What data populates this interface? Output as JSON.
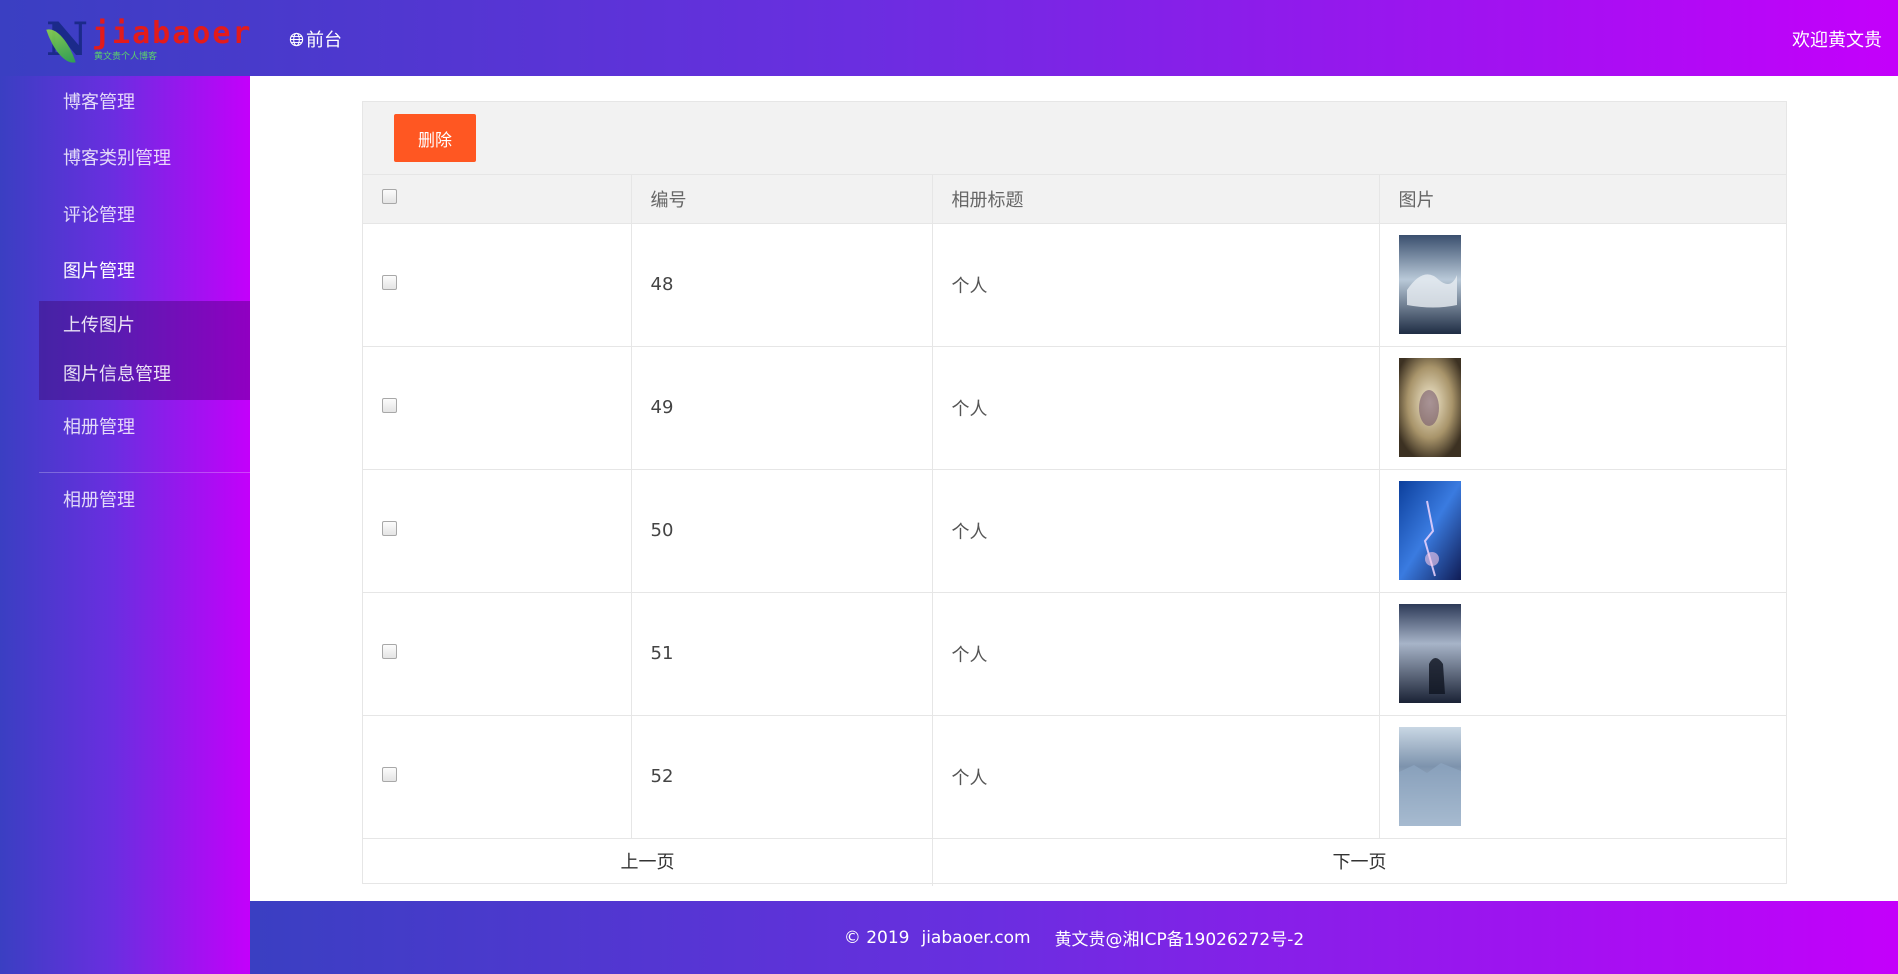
{
  "header": {
    "logo_text": "jiabaoer",
    "logo_subtitle": "黄文贵个人博客",
    "front_link": "前台",
    "welcome": "欢迎黄文贵"
  },
  "sidebar": {
    "items": [
      {
        "label": "博客管理"
      },
      {
        "label": "博客类别管理"
      },
      {
        "label": "评论管理"
      },
      {
        "label": "图片管理"
      },
      {
        "label": "相册管理"
      },
      {
        "label": "相册管理"
      }
    ],
    "sub_items": [
      {
        "label": "上传图片"
      },
      {
        "label": "图片信息管理"
      }
    ]
  },
  "toolbar": {
    "delete_label": "删除"
  },
  "table": {
    "headers": [
      "编号",
      "相册标题",
      "图片"
    ],
    "rows": [
      {
        "id": "48",
        "title": "个人"
      },
      {
        "id": "49",
        "title": "个人"
      },
      {
        "id": "50",
        "title": "个人"
      },
      {
        "id": "51",
        "title": "个人"
      },
      {
        "id": "52",
        "title": "个人"
      }
    ]
  },
  "pager": {
    "prev": "上一页",
    "next": "下一页"
  },
  "footer": {
    "copyright": "© 2019",
    "site": "jiabaoer.com",
    "icp": "黄文贵@湘ICP备19026272号-2"
  }
}
